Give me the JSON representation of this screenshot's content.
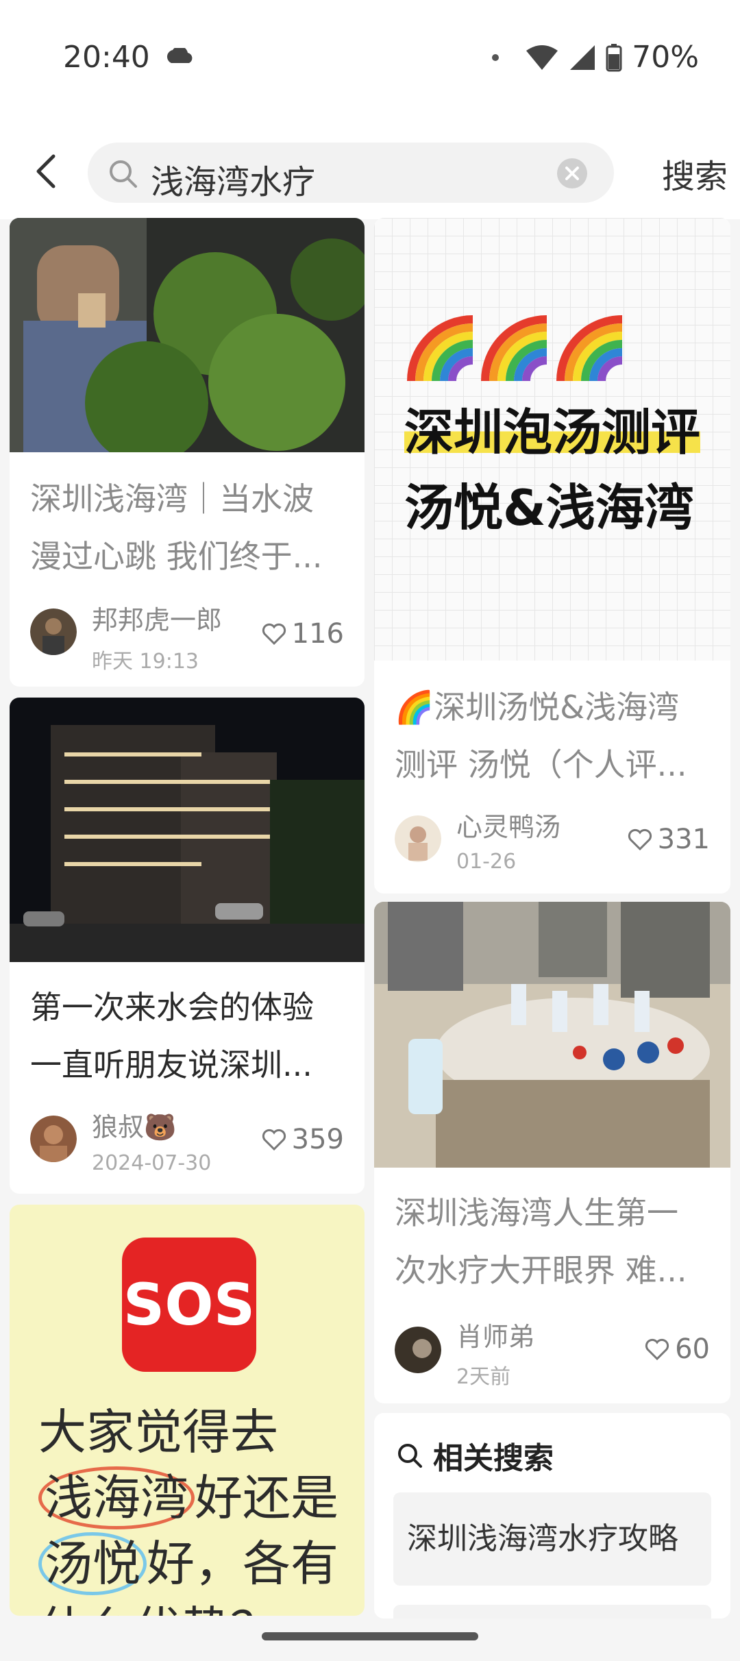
{
  "status": {
    "time": "20:40",
    "battery": "70%"
  },
  "search": {
    "query": "浅海湾水疗",
    "button": "搜索"
  },
  "cards": [
    {
      "title_line1": "深圳浅海湾｜当水波",
      "title_line2": "漫过心跳 我们终于...",
      "author": "邦邦虎一郎",
      "date": "昨天 19:13",
      "likes": "116"
    },
    {
      "title_line1": "第一次来水会的体验",
      "title_line2": "一直听朋友说深圳...",
      "author": "狼叔🐻",
      "date": "2024-07-30",
      "likes": "359"
    },
    {
      "poster_line1": "大家觉得去",
      "poster_line2_a": "浅海湾",
      "poster_line2_b": "好还是",
      "poster_line3_a": "汤悦",
      "poster_line3_b": "好，各有",
      "poster_line4": "什么优势？",
      "sos": "SOS"
    },
    {
      "cover_line1": "深圳泡汤测评",
      "cover_line2": "汤悦&浅海湾",
      "title_line1": "🌈深圳汤悦&浅海湾",
      "title_line2": "测评 汤悦（个人评...",
      "author": "心灵鸭汤",
      "date": "01-26",
      "likes": "331"
    },
    {
      "title_line1": "深圳浅海湾人生第一",
      "title_line2": "次水疗大开眼界 难...",
      "author": "肖师弟",
      "date": "2天前",
      "likes": "60"
    }
  ],
  "related": {
    "heading": "相关搜索",
    "items": [
      "深圳浅海湾水疗攻略"
    ]
  }
}
